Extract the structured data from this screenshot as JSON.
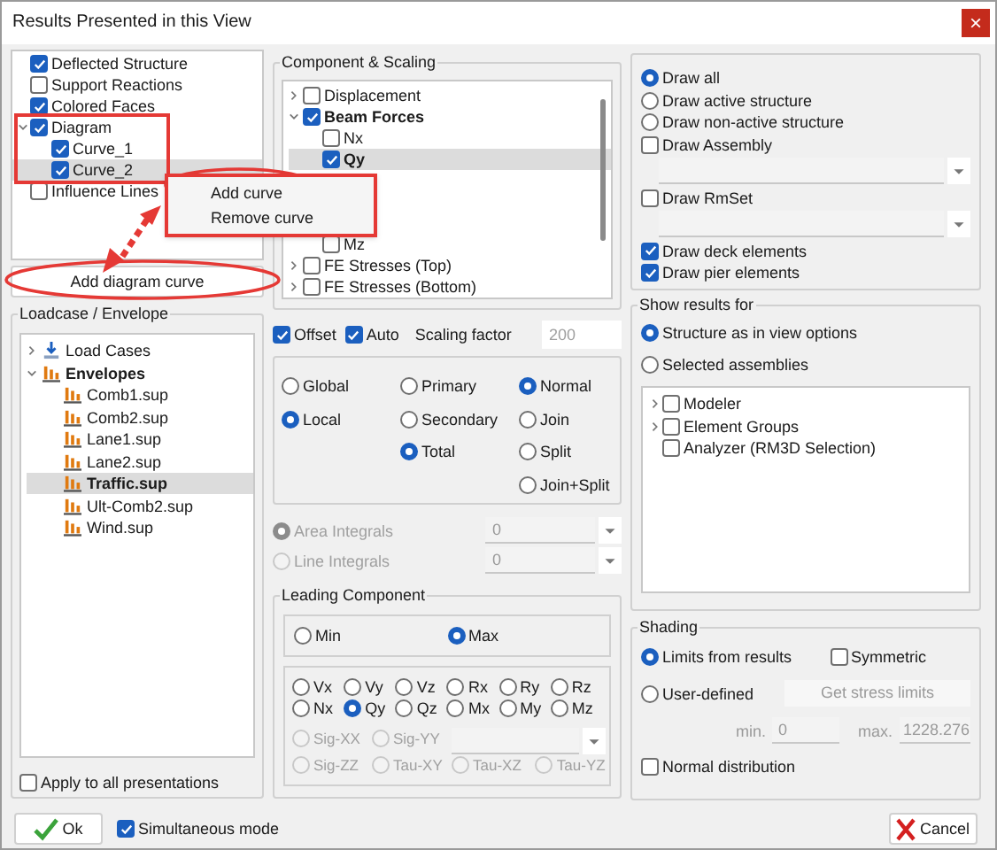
{
  "window": {
    "title": "Results Presented in this View",
    "close": "×"
  },
  "results_tree": [
    {
      "label": "Deflected Structure",
      "checked": true
    },
    {
      "label": "Support Reactions",
      "checked": false
    },
    {
      "label": "Colored Faces",
      "checked": true
    },
    {
      "label": "Diagram",
      "checked": true,
      "expanded": true,
      "children": [
        {
          "label": "Curve_1",
          "checked": true,
          "selected": false
        },
        {
          "label": "Curve_2",
          "checked": true,
          "selected": true
        }
      ]
    },
    {
      "label": "Influence Lines",
      "checked": false
    }
  ],
  "context_menu": [
    "Add curve",
    "Remove curve"
  ],
  "add_diagram_curve": "Add diagram curve",
  "loadcase": {
    "title": "Loadcase / Envelope",
    "tree": [
      {
        "label": "Load Cases",
        "kind": "loadcases",
        "expanded": false,
        "selected": false
      },
      {
        "label": "Envelopes",
        "kind": "envelopes",
        "expanded": true,
        "selected": false,
        "children": [
          {
            "label": "Comb1.sup",
            "kind": "envelope",
            "selected": false
          },
          {
            "label": "Comb2.sup",
            "kind": "envelope",
            "selected": false
          },
          {
            "label": "Lane1.sup",
            "kind": "envelope",
            "selected": false
          },
          {
            "label": "Lane2.sup",
            "kind": "envelope",
            "selected": false
          },
          {
            "label": "Traffic.sup",
            "kind": "envelope",
            "selected": true
          },
          {
            "label": "Ult-Comb2.sup",
            "kind": "envelope",
            "selected": false
          },
          {
            "label": "Wind.sup",
            "kind": "envelope",
            "selected": false
          }
        ]
      }
    ],
    "apply_all": {
      "label": "Apply to all presentations",
      "checked": false
    }
  },
  "component": {
    "title": "Component & Scaling",
    "tree": [
      {
        "label": "Displacement",
        "checked": false,
        "expanded": false
      },
      {
        "label": "Beam Forces",
        "checked": true,
        "expanded": true,
        "children": [
          {
            "label": "Nx",
            "checked": false,
            "selected": false
          },
          {
            "label": "Qy",
            "checked": true,
            "selected": true
          },
          {
            "label": "Mz",
            "checked": false,
            "selected": false
          }
        ]
      },
      {
        "label": "FE Stresses (Top)",
        "checked": false,
        "expanded": false
      },
      {
        "label": "FE Stresses (Bottom)",
        "checked": false,
        "expanded": false
      }
    ],
    "offset": {
      "label": "Offset",
      "checked": true
    },
    "auto": {
      "label": "Auto",
      "checked": true
    },
    "scaling_label": "Scaling factor",
    "scaling_value": "200"
  },
  "coordinate": [
    {
      "label": "Global",
      "selected": false
    },
    {
      "label": "Local",
      "selected": true
    }
  ],
  "part": [
    {
      "label": "Primary",
      "selected": false
    },
    {
      "label": "Secondary",
      "selected": false
    },
    {
      "label": "Total",
      "selected": true
    }
  ],
  "mode": [
    {
      "label": "Normal",
      "selected": true
    },
    {
      "label": "Join",
      "selected": false
    },
    {
      "label": "Split",
      "selected": false
    },
    {
      "label": "Join+Split",
      "selected": false
    }
  ],
  "integrals": [
    {
      "label": "Area Integrals",
      "selected": true,
      "value": "0"
    },
    {
      "label": "Line Integrals",
      "selected": false,
      "value": "0"
    }
  ],
  "leading": {
    "title": "Leading Component",
    "extreme": [
      {
        "label": "Min",
        "selected": false
      },
      {
        "label": "Max",
        "selected": true
      }
    ],
    "components": [
      {
        "label": "Vx",
        "selected": false
      },
      {
        "label": "Vy",
        "selected": false
      },
      {
        "label": "Vz",
        "selected": false
      },
      {
        "label": "Rx",
        "selected": false
      },
      {
        "label": "Ry",
        "selected": false
      },
      {
        "label": "Rz",
        "selected": false
      },
      {
        "label": "Nx",
        "selected": false
      },
      {
        "label": "Qy",
        "selected": true
      },
      {
        "label": "Qz",
        "selected": false
      },
      {
        "label": "Mx",
        "selected": false
      },
      {
        "label": "My",
        "selected": false
      },
      {
        "label": "Mz",
        "selected": false
      }
    ],
    "stresses": [
      {
        "label": "Sig-XX",
        "selected": false
      },
      {
        "label": "Sig-YY",
        "selected": false
      },
      {
        "label": "Sig-ZZ",
        "selected": false
      },
      {
        "label": "Tau-XY",
        "selected": false
      },
      {
        "label": "Tau-XZ",
        "selected": false
      },
      {
        "label": "Tau-YZ",
        "selected": false
      }
    ]
  },
  "draw": [
    {
      "kind": "radio",
      "label": "Draw all",
      "selected": true
    },
    {
      "kind": "radio",
      "label": "Draw active structure",
      "selected": false
    },
    {
      "kind": "radio",
      "label": "Draw non-active structure",
      "selected": false
    },
    {
      "kind": "check",
      "label": "Draw Assembly",
      "checked": false
    },
    {
      "kind": "dropdown"
    },
    {
      "kind": "check",
      "label": "Draw RmSet",
      "checked": false
    },
    {
      "kind": "dropdown"
    },
    {
      "kind": "check",
      "label": "Draw deck elements",
      "checked": true
    },
    {
      "kind": "check",
      "label": "Draw pier elements",
      "checked": true
    }
  ],
  "show_results": {
    "title": "Show results for",
    "options": [
      {
        "label": "Structure as in view options",
        "selected": true
      },
      {
        "label": "Selected assemblies",
        "selected": false
      }
    ],
    "assemblies": [
      {
        "label": "Modeler",
        "checked": false,
        "expandable": true
      },
      {
        "label": "Element Groups",
        "checked": false,
        "expandable": true
      },
      {
        "label": "Analyzer (RM3D Selection)",
        "checked": false,
        "expandable": false
      }
    ]
  },
  "shading": {
    "title": "Shading",
    "limits": {
      "label": "Limits from results",
      "selected": true
    },
    "symmetric": {
      "label": "Symmetric",
      "checked": false
    },
    "user": {
      "label": "User-defined",
      "selected": false
    },
    "get_limits": "Get stress limits",
    "min_label": "min.",
    "min": "0",
    "max_label": "max.",
    "max": "1228.276",
    "normal": {
      "label": "Normal distribution",
      "checked": false
    }
  },
  "footer": {
    "ok": "Ok",
    "simultaneous": {
      "label": "Simultaneous mode",
      "checked": true
    },
    "cancel": "Cancel"
  }
}
